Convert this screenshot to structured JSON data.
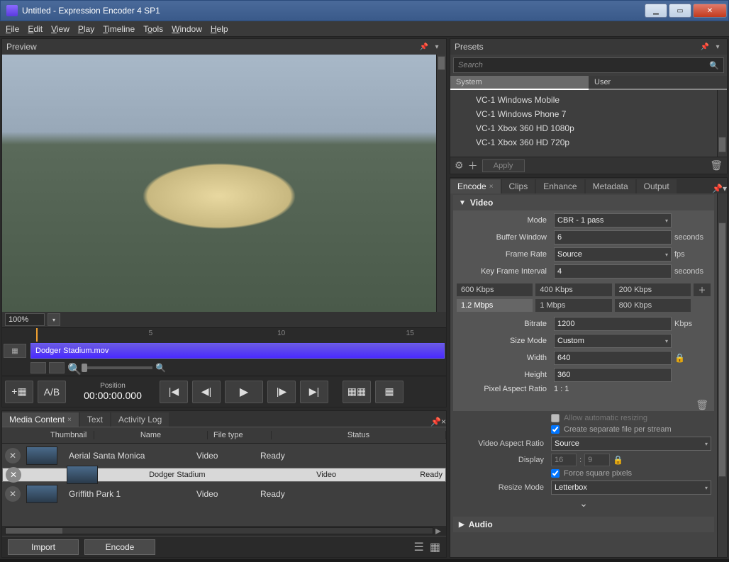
{
  "window": {
    "title": "Untitled - Expression Encoder 4 SP1"
  },
  "menu": [
    "File",
    "Edit",
    "View",
    "Play",
    "Timeline",
    "Tools",
    "Window",
    "Help"
  ],
  "preview": {
    "title": "Preview",
    "zoom": "100%",
    "ticks": [
      "5",
      "10",
      "15"
    ],
    "clip_name": "Dodger Stadium.mov",
    "position_label": "Position",
    "position": "00:00:00.000",
    "ab_label": "A/B"
  },
  "media": {
    "tabs": [
      "Media Content",
      "Text",
      "Activity Log"
    ],
    "active_tab": 0,
    "columns": [
      "Thumbnail",
      "Name",
      "File type",
      "Status"
    ],
    "rows": [
      {
        "name": "Aerial Santa Monica",
        "type": "Video",
        "status": "Ready"
      },
      {
        "name": "Dodger Stadium",
        "type": "Video",
        "status": "Ready"
      },
      {
        "name": "Griffith Park 1",
        "type": "Video",
        "status": "Ready"
      }
    ],
    "selected": 1,
    "import_label": "Import",
    "encode_label": "Encode"
  },
  "presets": {
    "title": "Presets",
    "search_placeholder": "Search",
    "tabs": [
      "System",
      "User"
    ],
    "active_tab": 0,
    "items": [
      "VC-1 Windows Mobile",
      "VC-1 Windows Phone 7",
      "VC-1 Xbox 360 HD 1080p",
      "VC-1 Xbox 360 HD 720p"
    ],
    "apply_label": "Apply"
  },
  "encode_tabs": {
    "tabs": [
      "Encode",
      "Clips",
      "Enhance",
      "Metadata",
      "Output"
    ],
    "active": 0
  },
  "video": {
    "section": "Video",
    "mode_label": "Mode",
    "mode": "CBR - 1 pass",
    "buffer_label": "Buffer Window",
    "buffer": "6",
    "buffer_unit": "seconds",
    "framerate_label": "Frame Rate",
    "framerate": "Source",
    "framerate_unit": "fps",
    "keyframe_label": "Key Frame Interval",
    "keyframe": "4",
    "keyframe_unit": "seconds",
    "bitrates_top": [
      "600 Kbps",
      "400 Kbps",
      "200 Kbps"
    ],
    "bitrates_bot": [
      "1.2 Mbps",
      "1 Mbps",
      "800 Kbps"
    ],
    "bitrate_label": "Bitrate",
    "bitrate": "1200",
    "bitrate_unit": "Kbps",
    "sizemode_label": "Size Mode",
    "sizemode": "Custom",
    "width_label": "Width",
    "width": "640",
    "height_label": "Height",
    "height": "360",
    "par_label": "Pixel Aspect Ratio",
    "par": "1 : 1",
    "allow_resize": "Allow automatic resizing",
    "create_sep": "Create separate file per stream",
    "var_label": "Video Aspect Ratio",
    "var": "Source",
    "display_label": "Display",
    "display_w": "16",
    "display_h": "9",
    "force_sq": "Force square pixels",
    "resize_label": "Resize Mode",
    "resize": "Letterbox"
  },
  "audio": {
    "section": "Audio"
  }
}
